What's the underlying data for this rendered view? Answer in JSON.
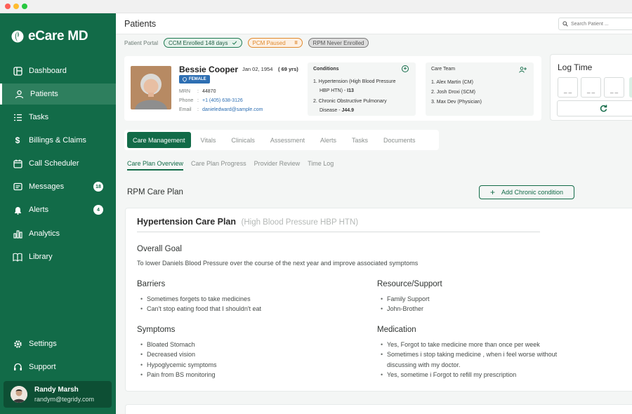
{
  "app": {
    "name": "eCare MD"
  },
  "sidebar": {
    "items": [
      {
        "label": "Dashboard",
        "icon": "dashboard-icon"
      },
      {
        "label": "Patients",
        "icon": "person-icon",
        "active": true
      },
      {
        "label": "Tasks",
        "icon": "tasks-icon"
      },
      {
        "label": "Billings & Claims",
        "icon": "dollar-icon"
      },
      {
        "label": "Call Scheduler",
        "icon": "calendar-icon"
      },
      {
        "label": "Messages",
        "icon": "message-icon",
        "badge": "18"
      },
      {
        "label": "Alerts",
        "icon": "bell-icon",
        "badge": "4"
      },
      {
        "label": "Analytics",
        "icon": "bar-chart-icon"
      },
      {
        "label": "Library",
        "icon": "book-icon"
      }
    ],
    "bottom_items": [
      {
        "label": "Settings",
        "icon": "gear-icon"
      },
      {
        "label": "Support",
        "icon": "headset-icon"
      }
    ],
    "user": {
      "name": "Randy Marsh",
      "email": "randym@tegridy.com"
    }
  },
  "header": {
    "title": "Patients",
    "search_placeholder": "Search Patient ..."
  },
  "portal": {
    "label": "Patient Portal",
    "badges": [
      {
        "text": "CCM Enrolled 148 days",
        "color": "#1f7a52"
      },
      {
        "text": "PCM Paused",
        "color": "#e08a2e"
      },
      {
        "text": "RPM Never Enrolled",
        "color": "#6b6b6b"
      }
    ]
  },
  "patient": {
    "name": "Bessie Cooper",
    "dob": "Jan 02, 1954",
    "age": "( 69 yrs)",
    "gender": "FEMALE",
    "mrn_label": "MRN",
    "mrn": "44870",
    "phone_label": "Phone",
    "phone": "+1 (405) 638-3126",
    "email_label": "Email",
    "email": "danieledward@sample.com"
  },
  "conditions": {
    "title": "Conditions",
    "items": [
      {
        "line1": "1. Hypertension (High Blood Pressure",
        "line2": "HBP HTN) - ",
        "code": "I13"
      },
      {
        "line1": "2. Chronic Obstructive Pulmonary",
        "line2": "Disease - ",
        "code": "J44.9"
      }
    ]
  },
  "care_team": {
    "title": "Care Team",
    "items": [
      "1. Alex Martin (CM)",
      "2. Josh Droxi (SCM)",
      "3. Max Dev (Physician)"
    ]
  },
  "log_time": {
    "title": "Log Time",
    "placeholder": "_ _"
  },
  "tabs": [
    "Care Management",
    "Vitals",
    "Clinicals",
    "Assessment",
    "Alerts",
    "Tasks",
    "Documents"
  ],
  "subtabs": [
    "Care Plan Overview",
    "Care Plan Progress",
    "Provider Review",
    "Time Log"
  ],
  "section_title": "RPM Care Plan",
  "add_condition_label": "Add Chronic condition",
  "care_plan": {
    "title": "Hypertension Care Plan",
    "subtitle": "(High Blood Pressure HBP HTN)",
    "goal_title": "Overall Goal",
    "goal_text": "To lower Daniels Blood Pressure over the course of the next year and improve associated symptoms",
    "barriers_title": "Barriers",
    "barriers": [
      "Sometimes forgets to take medicines",
      "Can't stop eating food that I shouldn't eat"
    ],
    "resource_title": "Resource/Support",
    "resources": [
      "Family Support",
      "John-Brother"
    ],
    "symptoms_title": "Symptoms",
    "symptoms": [
      "Bloated Stomach",
      "Decreased vision",
      "Hypoglycemic symptoms",
      "Pain from BS monitoring"
    ],
    "medication_title": "Medication",
    "medications": [
      "Yes, Forgot to take medicine more than once per week",
      "Sometimes i stop taking medicine , when i feel worse without discussing with my doctor.",
      "Yes, sometime i Forgot to refill my prescription"
    ]
  },
  "colors": {
    "brand": "#126b48",
    "accent": "#1f7a52"
  }
}
